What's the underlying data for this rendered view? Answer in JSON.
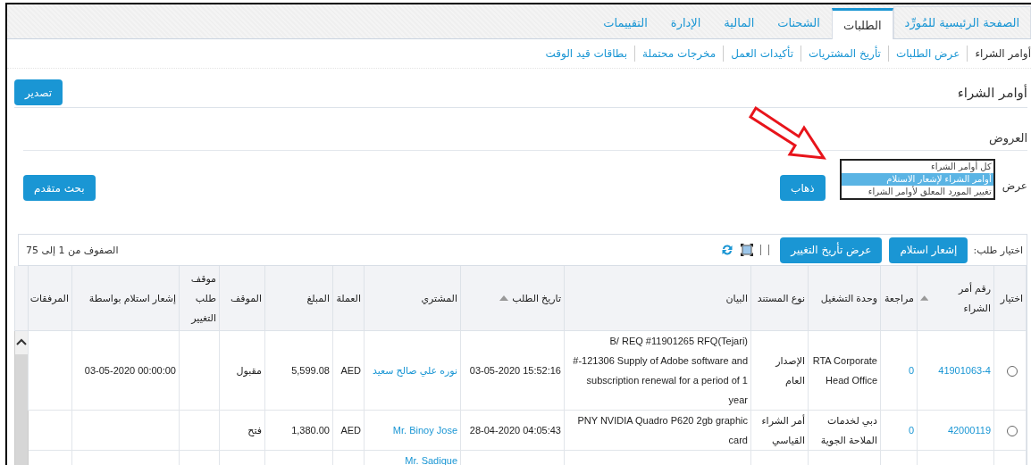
{
  "tabs": [
    {
      "label": "الصفحة الرئيسية للمُورِّد",
      "selected": false
    },
    {
      "label": "الطلبات",
      "selected": true
    },
    {
      "label": "الشحنات",
      "selected": false
    },
    {
      "label": "المالية",
      "selected": false
    },
    {
      "label": "الإدارة",
      "selected": false
    },
    {
      "label": "التقييمات",
      "selected": false
    }
  ],
  "subnav": [
    {
      "label": "أوامر الشراء",
      "selected": true
    },
    {
      "label": "عرض الطلبات",
      "selected": false
    },
    {
      "label": "تأريخ المشتريات",
      "selected": false
    },
    {
      "label": "تأكيدات العمل",
      "selected": false
    },
    {
      "label": "مخرجات محتملة",
      "selected": false
    },
    {
      "label": "بطاقات قيد الوقت",
      "selected": false
    }
  ],
  "page_title": "أوامر الشراء",
  "export_button": "تصدير",
  "views": {
    "title": "العروض",
    "label": "عرض",
    "options": [
      {
        "label": "كل أوامر الشراء",
        "selected": false
      },
      {
        "label": "أوامر الشراء لإشعار الاستلام",
        "selected": true
      },
      {
        "label": "تغيير المورد المعلق لأوامر الشراء",
        "selected": false
      }
    ],
    "go_button": "ذهاب",
    "advanced_search_button": "بحث متقدم"
  },
  "table": {
    "select_label": "اختيار طلب:",
    "actions": [
      "إشعار استلام",
      "عرض تأريخ التغيير"
    ],
    "row_count": "الصفوف من 1 إلى 75",
    "columns": [
      {
        "label": "اختيار"
      },
      {
        "label": "رقم أمر الشراء",
        "sorted": true
      },
      {
        "label": "مراجعة"
      },
      {
        "label": "وحدة التشغيل"
      },
      {
        "label": "نوع المستند"
      },
      {
        "label": "البيان"
      },
      {
        "label": "تاريخ الطلب",
        "sorted": true
      },
      {
        "label": "المشتري"
      },
      {
        "label": "العملة"
      },
      {
        "label": "المبلغ"
      },
      {
        "label": "الموقف"
      },
      {
        "label": "موقف طلب التغيير"
      },
      {
        "label": "إشعار استلام بواسطة"
      },
      {
        "label": "المرفقات"
      }
    ],
    "rows": [
      {
        "cells": [
          {
            "kind": "radio",
            "selected": false
          },
          {
            "text": "41901063-4",
            "kind": "link"
          },
          {
            "text": "0",
            "kind": "link"
          },
          {
            "text": "RTA Corporate Head Office",
            "kind": "text"
          },
          {
            "text": "الإصدار العام",
            "kind": "text"
          },
          {
            "text": "B/ REQ #11901265 RFQ(Tejari) #-121306 Supply of Adobe software and subscription renewal for a period of 1 year",
            "kind": "text"
          },
          {
            "text": "03-05-2020 15:52:16",
            "kind": "text"
          },
          {
            "text": "نوره علي صالح سعيد",
            "kind": "link"
          },
          {
            "text": "AED",
            "kind": "text"
          },
          {
            "text": "5,599.08",
            "kind": "text"
          },
          {
            "text": "مقبول",
            "kind": "text"
          },
          "",
          {
            "text": "03-05-2020 00:00:00",
            "kind": "text"
          },
          ""
        ]
      },
      {
        "cells": [
          {
            "kind": "radio",
            "selected": false
          },
          {
            "text": "42000119",
            "kind": "link"
          },
          {
            "text": "0",
            "kind": "link"
          },
          {
            "text": "دبي لخدمات الملاحة الجوية",
            "kind": "text"
          },
          {
            "text": "أمر الشراء القياسي",
            "kind": "text"
          },
          {
            "text": "PNY NVIDIA Quadro P620 2gb graphic card",
            "kind": "text"
          },
          {
            "text": "28-04-2020 04:05:43",
            "kind": "text"
          },
          {
            "text": "Mr. Binoy Jose",
            "kind": "link"
          },
          {
            "text": "AED",
            "kind": "text"
          },
          {
            "text": "1,380.00",
            "kind": "text"
          },
          {
            "text": "فتح",
            "kind": "text"
          },
          "",
          "",
          ""
        ]
      },
      {
        "cells": [
          "",
          "",
          "",
          "",
          "",
          "",
          "",
          {
            "text": "Mr. Sadique",
            "kind": "link"
          },
          "",
          "",
          "",
          "",
          "",
          ""
        ]
      }
    ]
  }
}
